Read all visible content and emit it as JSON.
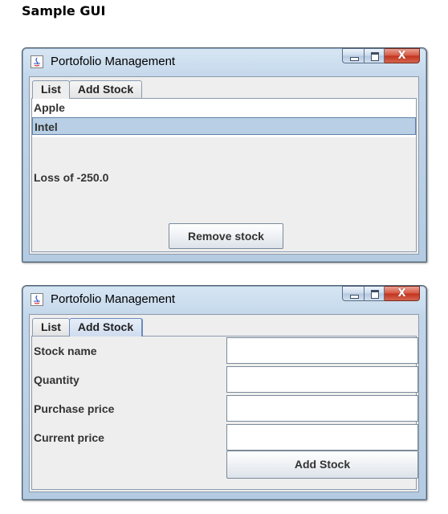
{
  "document": {
    "heading": "Sample GUI"
  },
  "window_list": {
    "title": "Portofolio Management",
    "tabs": [
      {
        "label": "List"
      },
      {
        "label": "Add Stock"
      }
    ],
    "active_tab": "List",
    "stocks": [
      {
        "name": "Apple",
        "selected": false
      },
      {
        "name": "Intel",
        "selected": true
      }
    ],
    "status_text": "Loss of -250.0",
    "remove_button": "Remove stock"
  },
  "window_add": {
    "title": "Portofolio Management",
    "tabs": [
      {
        "label": "List"
      },
      {
        "label": "Add Stock"
      }
    ],
    "active_tab": "Add Stock",
    "fields": [
      {
        "label": "Stock name",
        "value": ""
      },
      {
        "label": "Quantity",
        "value": ""
      },
      {
        "label": "Purchase price",
        "value": ""
      },
      {
        "label": "Current price",
        "value": ""
      }
    ],
    "add_button": "Add Stock"
  },
  "window_controls": {
    "minimize_icon": "minimize-icon",
    "maximize_icon": "maximize-icon",
    "close_icon": "close-icon",
    "close_glyph": "X",
    "app_icon": "java-app-icon"
  },
  "colors": {
    "selection": "#b8cfe5",
    "titlebar": "#c2d6ea",
    "close_button": "#c2321d"
  }
}
